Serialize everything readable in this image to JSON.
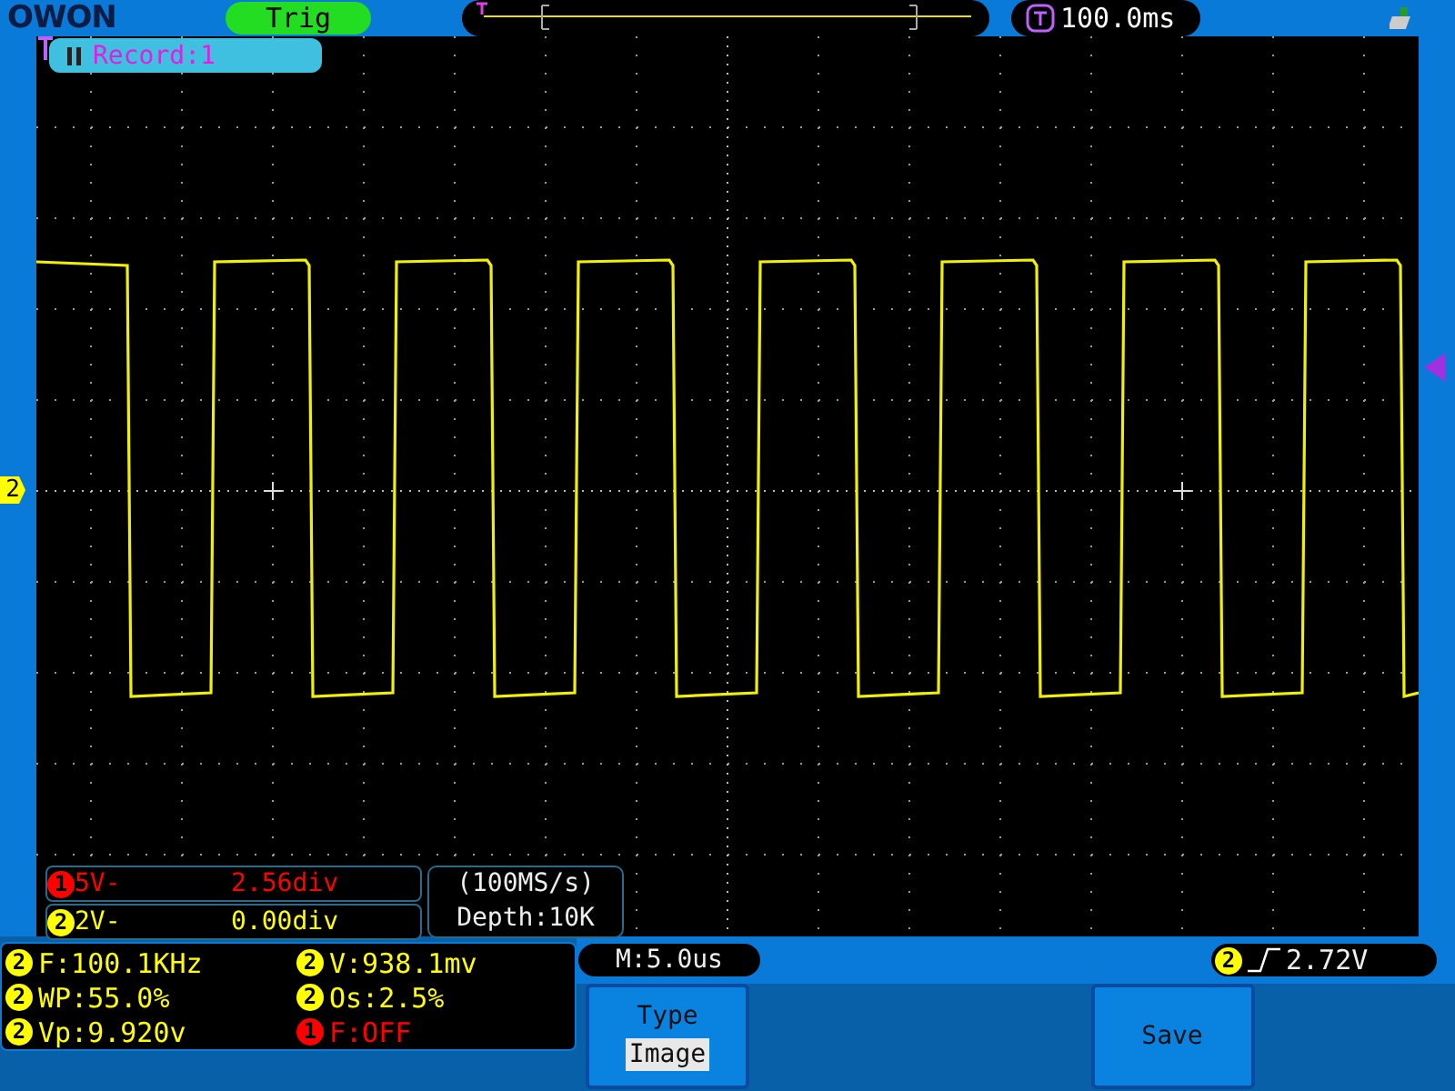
{
  "top_bar": {
    "logo": "OWON",
    "status": "Trig",
    "timebase_delay": "100.0ms"
  },
  "record": {
    "label": "Record:1"
  },
  "display": {
    "ground_marker": "2"
  },
  "channels": [
    {
      "badge": "1",
      "scale": "5V-",
      "offset": "2.56div",
      "color": "#ff0000"
    },
    {
      "badge": "2",
      "scale": "2V-",
      "offset": "0.00div",
      "color": "#ffff00"
    }
  ],
  "acquisition": {
    "sample_rate": "(100MS/s)",
    "depth": "Depth:10K"
  },
  "measurements": [
    {
      "channel": "2",
      "text": "F:100.1KHz",
      "color": "#ffff00"
    },
    {
      "channel": "2",
      "text": "V:938.1mv",
      "color": "#ffff00"
    },
    {
      "channel": "2",
      "text": "WP:55.0%",
      "color": "#ffff00"
    },
    {
      "channel": "2",
      "text": "Os:2.5%",
      "color": "#ffff00"
    },
    {
      "channel": "2",
      "text": "Vp:9.920v",
      "color": "#ffff00"
    },
    {
      "channel": "1",
      "text": "F:OFF",
      "color": "#ff0000"
    }
  ],
  "timebase": "M:5.0us",
  "trigger": {
    "channel": "2",
    "level": "2.72V",
    "color": "#ffff00"
  },
  "menu": [
    {
      "kind": "option",
      "title": "Type",
      "value": "Image"
    },
    {
      "kind": "blank"
    },
    {
      "kind": "blank"
    },
    {
      "kind": "action",
      "title": "Save"
    },
    {
      "kind": "blank"
    }
  ]
}
